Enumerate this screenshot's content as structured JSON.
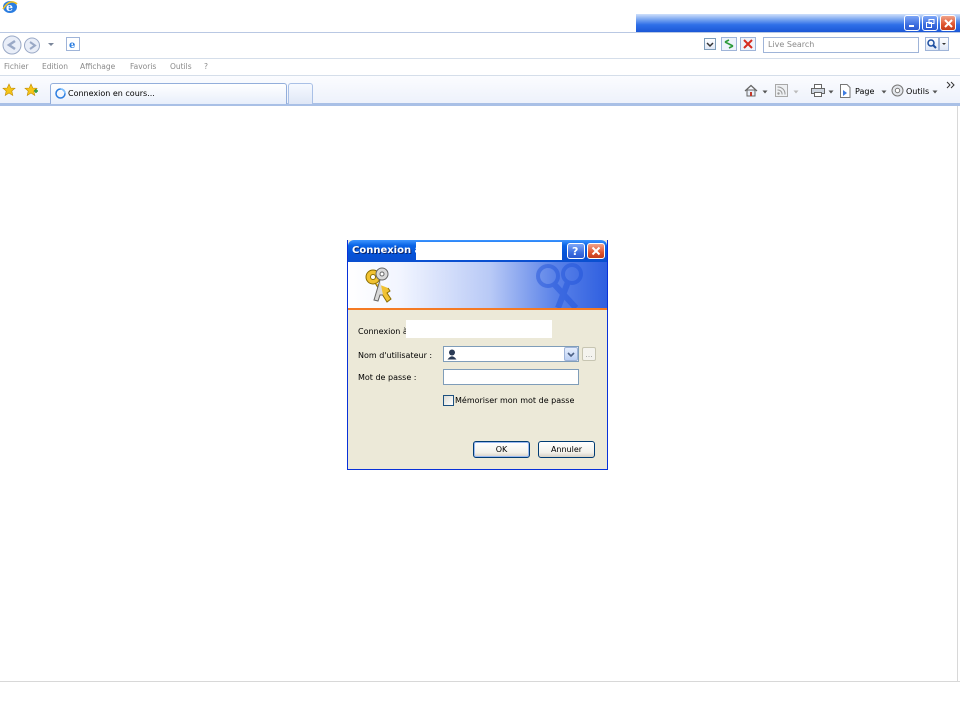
{
  "search": {
    "placeholder": "Live Search"
  },
  "menu": [
    "Fichier",
    "Edition",
    "Affichage",
    "Favoris",
    "Outils",
    "?"
  ],
  "tabs": {
    "active_label": "Connexion en cours..."
  },
  "commandbar": {
    "page_label": "Page",
    "tools_label": "Outils"
  },
  "dialog": {
    "title": "Connexion à",
    "intro_label": "Connexion à",
    "username_label": "Nom d'utilisateur :",
    "password_label": "Mot de passe :",
    "remember_label": "Mémoriser mon mot de passe",
    "remember_checked": false,
    "ok_label": "OK",
    "cancel_label": "Annuler",
    "browse_label": "..."
  },
  "colors": {
    "title_blue": "#0a64e6",
    "accent_orange": "#f47a24",
    "dialog_bg": "#ece9d8"
  }
}
